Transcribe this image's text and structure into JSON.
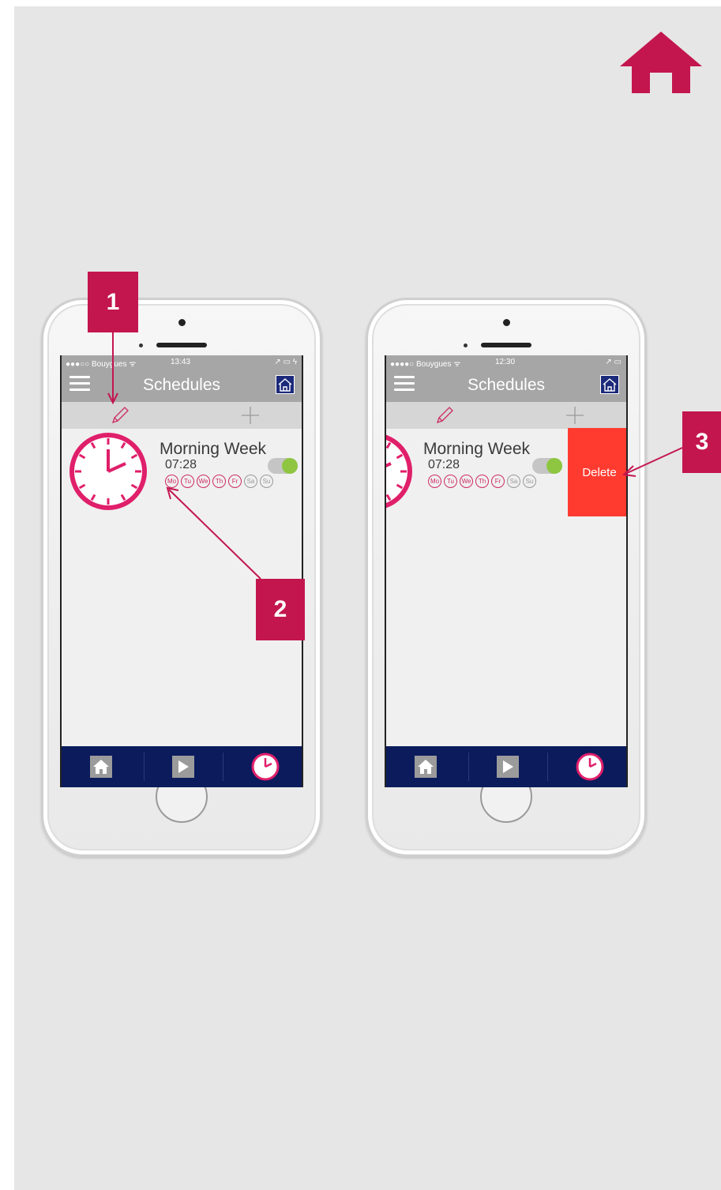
{
  "colors": {
    "accent": "#c3164f",
    "delete": "#ff3b30",
    "tabbar": "#0b1b5c",
    "toggle_on": "#8ec641",
    "navbar": "#a6a6a6"
  },
  "home_icon": "home-icon",
  "left_phone": {
    "status": {
      "carrier": "●●●○○ Bouygues ᯤ",
      "time": "13:43",
      "right": "↗ ▭ ϟ"
    },
    "title": "Schedules",
    "schedule": {
      "name": "Morning Week",
      "time": "07:28",
      "enabled": true
    },
    "days": [
      "Mo",
      "Tu",
      "We",
      "Th",
      "Fr",
      "Sa",
      "Su"
    ]
  },
  "right_phone": {
    "status": {
      "carrier": "●●●●○ Bouygues ᯤ",
      "time": "12:30",
      "right": "↗ ▭"
    },
    "title": "Schedules",
    "schedule": {
      "name": "Morning Week",
      "time": "07:28",
      "enabled": true
    },
    "days": [
      "Mo",
      "Tu",
      "We",
      "Th",
      "Fr",
      "Sa",
      "Su"
    ],
    "delete_label": "Delete"
  },
  "markers": [
    "1",
    "2",
    "3"
  ]
}
